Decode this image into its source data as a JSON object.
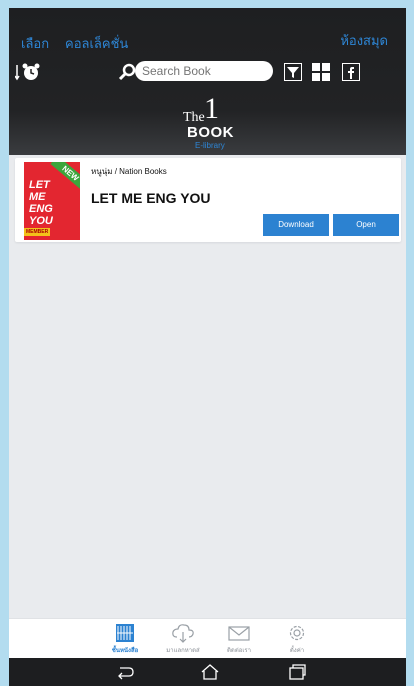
{
  "header": {
    "select_label": "เลือก",
    "collection_label": "คอลเล็คชั่น",
    "library_label": "ห้องสมุด",
    "search_placeholder": "Search Book",
    "logo": {
      "the": "The",
      "one": "1",
      "book": "BOOK",
      "elibrary": "E-library"
    }
  },
  "book": {
    "publisher": "หนูนุ่ม / Nation Books",
    "title": "LET ME ENG YOU",
    "cover": {
      "badge": "NEW",
      "lines": [
        "LET",
        "ME",
        "ENG",
        "YOU"
      ],
      "tag": "MEMBER"
    },
    "download_label": "Download",
    "open_label": "Open"
  },
  "tabs": [
    {
      "label": "ชั้นหนังสือ",
      "icon": "bookshelf-icon",
      "active": true
    },
    {
      "label": "มาแลกหาดส่",
      "icon": "cloud-download-icon",
      "active": false
    },
    {
      "label": "ติดต่อเรา",
      "icon": "envelope-icon",
      "active": false
    },
    {
      "label": "ตั้งค่า",
      "icon": "gear-icon",
      "active": false
    }
  ],
  "colors": {
    "accent": "#2c82d1",
    "header_bg": "#222325",
    "cover_red": "#e32630"
  }
}
